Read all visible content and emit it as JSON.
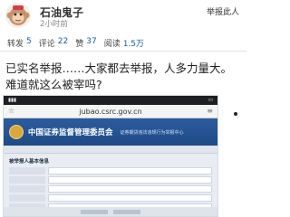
{
  "post": {
    "username": "石油鬼子",
    "time": "2小时前",
    "report_link": "举报此人",
    "stats": {
      "repost_label": "转发",
      "repost_count": "5",
      "comment_label": "评论",
      "comment_count": "22",
      "like_label": "赞",
      "like_count": "37",
      "read_label": "阅读",
      "read_count": "1.5万"
    },
    "content": "已实名举报……大家都去举报，人多力量大。难道就这么被宰吗?"
  },
  "screenshot": {
    "url": "jubao.csrc.gov.cn",
    "banner_title": "中国证券监督管理委员会",
    "banner_subtitle": "证券期货违法违规行为举报中心",
    "section_label": "被举报人基本信息"
  },
  "colors": {
    "link_blue": "#1a5aa8",
    "banner_blue": "#2c5c9e"
  }
}
